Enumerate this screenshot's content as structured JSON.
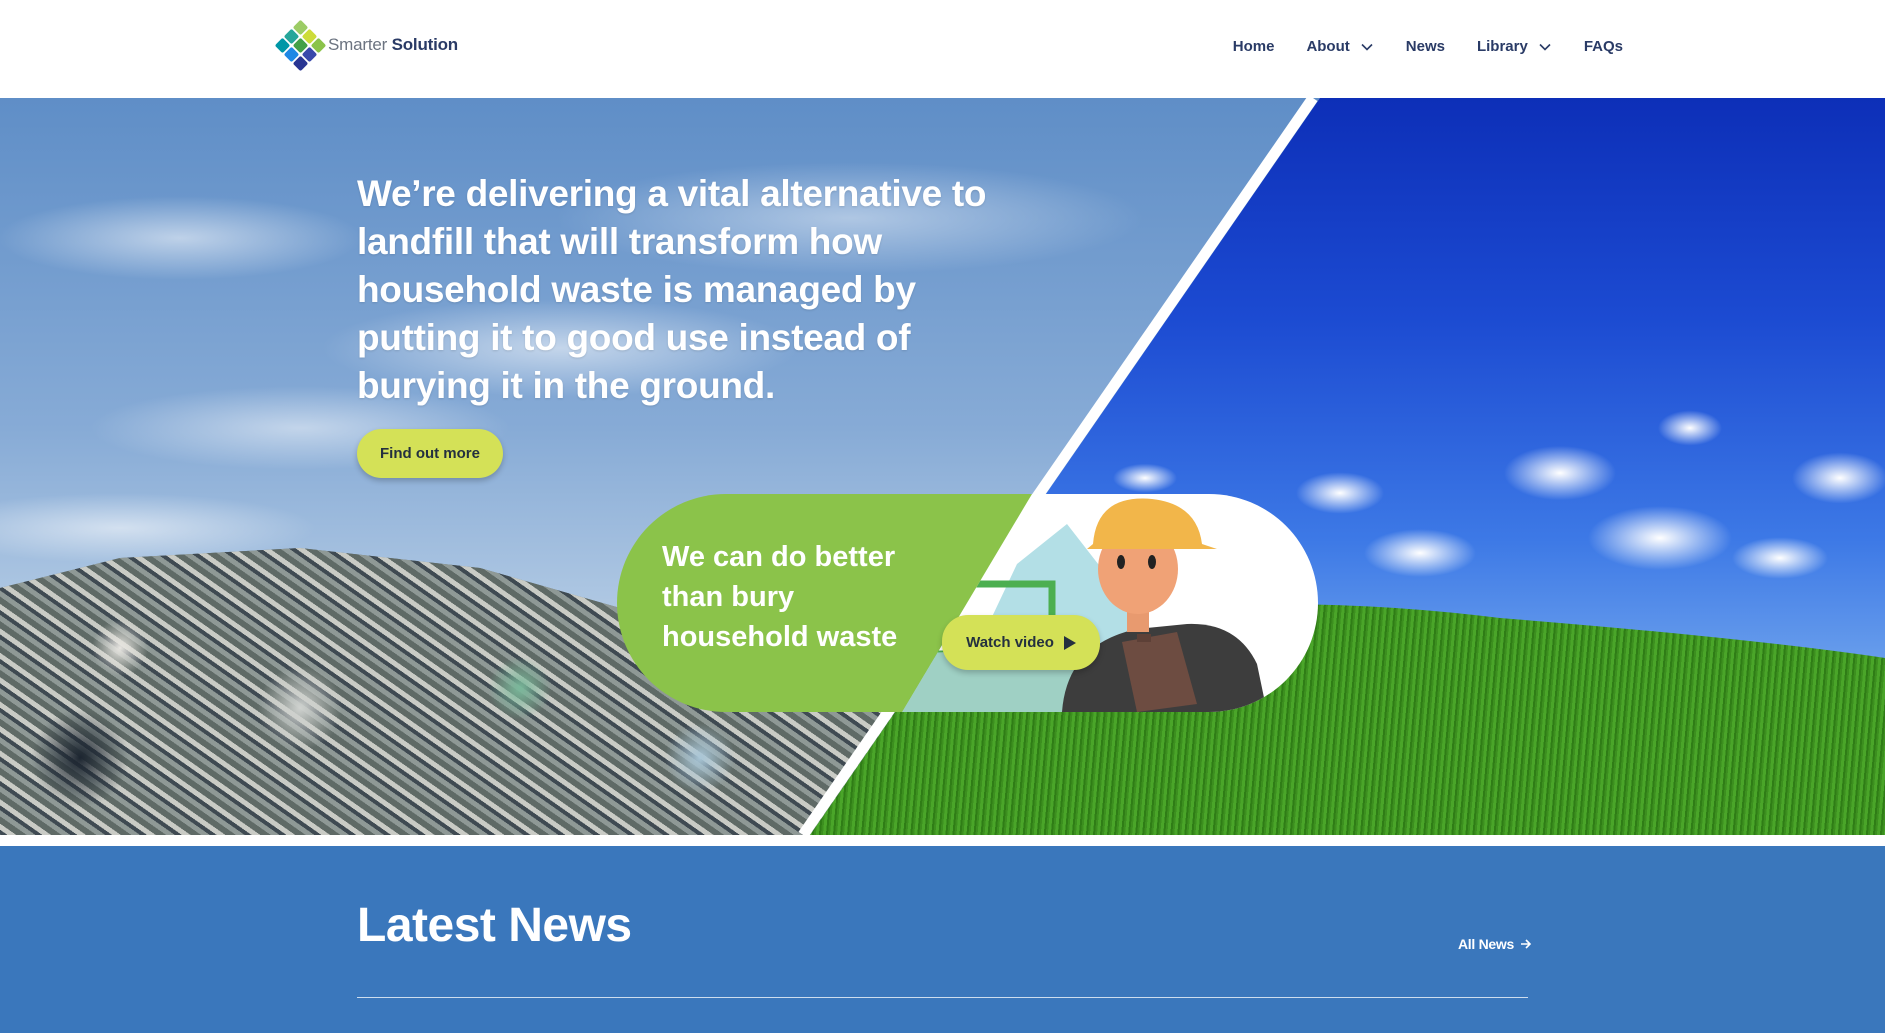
{
  "header": {
    "logo": {
      "light": "Smarter",
      "bold": "Solution"
    },
    "nav": [
      {
        "label": "Home",
        "dropdown": false
      },
      {
        "label": "About",
        "dropdown": true
      },
      {
        "label": "News",
        "dropdown": false
      },
      {
        "label": "Library",
        "dropdown": true
      },
      {
        "label": "FAQs",
        "dropdown": false
      }
    ]
  },
  "hero": {
    "heading": "We’re delivering a vital alternative to landfill that will transform how household waste is managed by putting it to good use instead of burying it in the ground.",
    "cta_label": "Find out more",
    "video": {
      "title": "We can do better than bury household waste",
      "button_label": "Watch video",
      "icon": "play-icon"
    }
  },
  "news": {
    "title": "Latest News",
    "all_label": "All News",
    "all_icon": "arrow-right-icon"
  },
  "colors": {
    "navy": "#2a3b66",
    "lime": "#d4e157",
    "green": "#8bc34a",
    "news_blue": "#3a77bc"
  }
}
